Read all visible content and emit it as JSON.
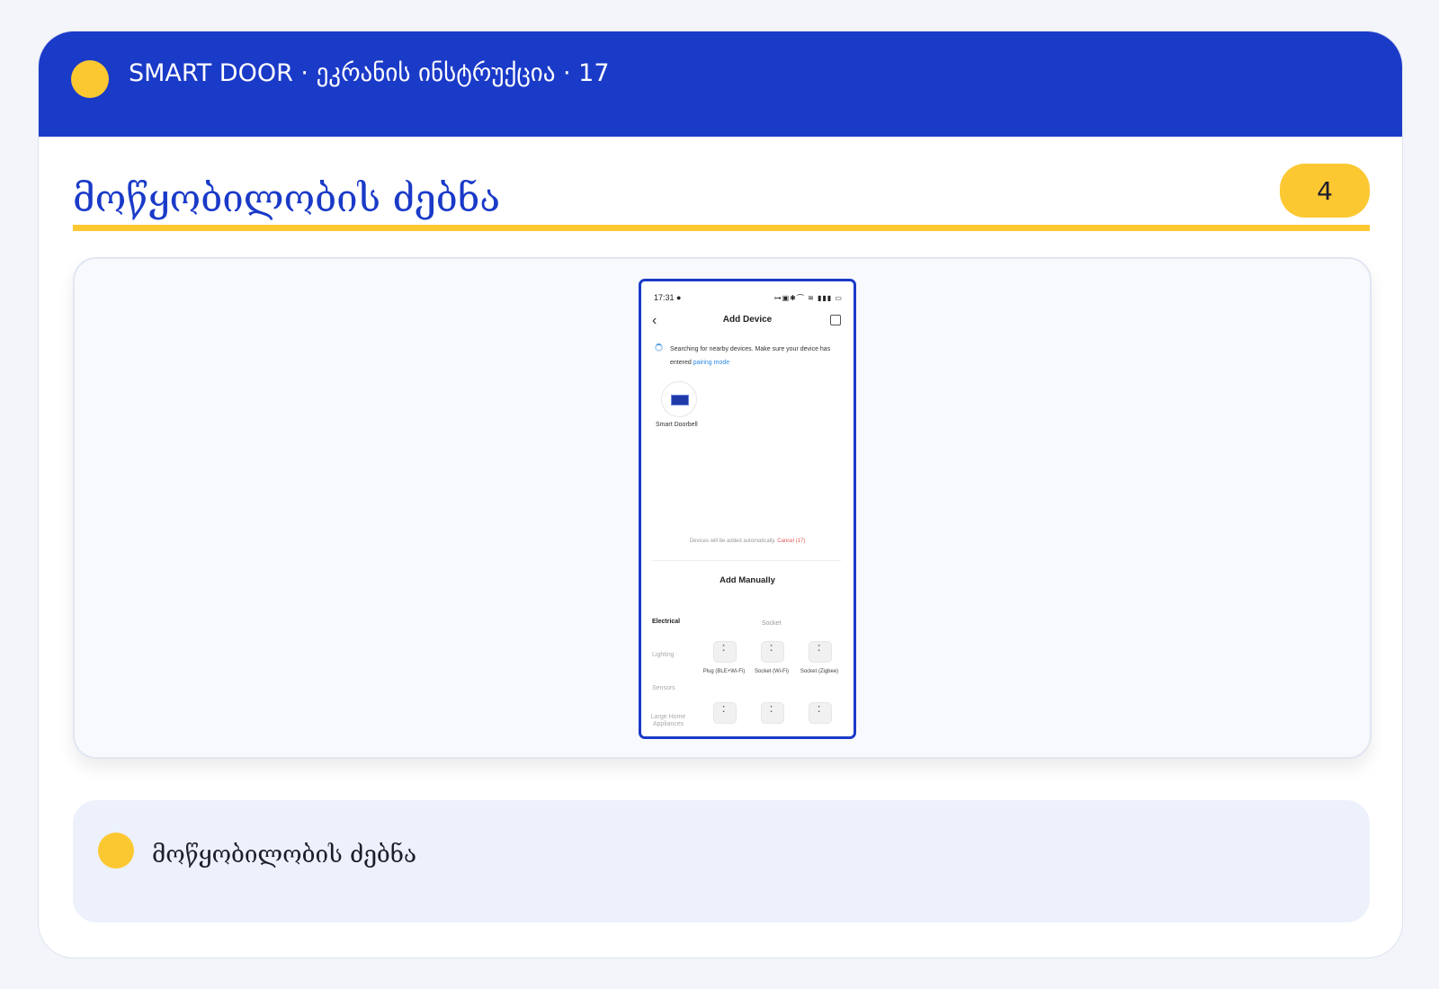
{
  "header": {
    "title": "SMART DOOR · ეკრანის ინსტრუქცია · 17"
  },
  "page": {
    "title": "მოწყობილობის ძებნა",
    "step_number": "4"
  },
  "phone": {
    "status_time": "17:31 ●",
    "status_icons": "⊶▣✱⌒ ≋ ▮▮▮ ▭",
    "screen_title": "Add Device",
    "search_message": "Searching for nearby devices. Make sure your device has entered ",
    "pairing_link": "pairing mode",
    "found_device": "Smart Doorbell",
    "auto_add_note": "Devices will be added automatically. ",
    "cancel_label": "Cancel (17)",
    "add_manually": "Add Manually",
    "categories": [
      "Electrical",
      "Lighting",
      "Sensors",
      "Large Home Appliances"
    ],
    "socket_heading": "Socket",
    "devices": [
      {
        "label": "Plug (BLE+Wi-Fi)"
      },
      {
        "label": "Socket (Wi-Fi)"
      },
      {
        "label": "Socket (Zigbee)"
      }
    ]
  },
  "note": {
    "text": "მოწყობილობის ძებნა"
  },
  "colors": {
    "brand_blue": "#1a3ac8",
    "accent_yellow": "#fcc832"
  }
}
